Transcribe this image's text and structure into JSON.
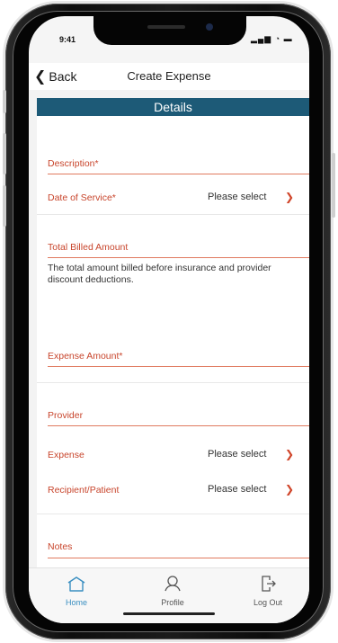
{
  "status_bar": {
    "time": "9:41",
    "icons": "▂▄▆ ◔ ▬"
  },
  "nav": {
    "back_label": "Back",
    "title": "Create Expense"
  },
  "section": {
    "title": "Details"
  },
  "form": {
    "description_label": "Description*",
    "date_of_service_label": "Date of Service*",
    "date_of_service_value": "Please select",
    "total_billed_label": "Total Billed Amount",
    "total_billed_help": "The total amount billed before insurance and provider discount deductions.",
    "expense_amount_label": "Expense Amount*",
    "provider_label": "Provider",
    "expense_label": "Expense",
    "expense_value": "Please select",
    "recipient_label": "Recipient/Patient",
    "recipient_value": "Please select",
    "notes_label": "Notes"
  },
  "tabbar": {
    "items": [
      {
        "label": "Home",
        "icon": "home-icon",
        "active": true
      },
      {
        "label": "Profile",
        "icon": "user-icon",
        "active": false
      },
      {
        "label": "Log Out",
        "icon": "logout-icon",
        "active": false
      }
    ]
  },
  "colors": {
    "accent": "#c8452c",
    "header_bar": "#1d5a77",
    "active_tab": "#3a8fc1",
    "inactive_tab": "#555555"
  }
}
